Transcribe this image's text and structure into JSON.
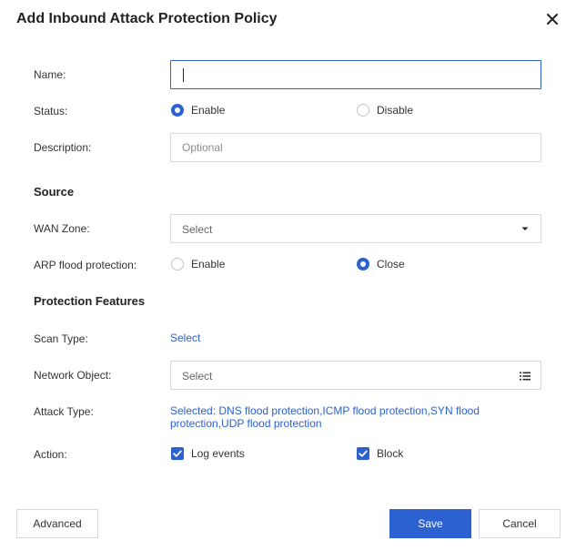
{
  "dialog": {
    "title": "Add Inbound Attack Protection Policy"
  },
  "form": {
    "name_label": "Name:",
    "name_value": "",
    "status_label": "Status:",
    "status_options": [
      "Enable",
      "Disable"
    ],
    "status_selected": "Enable",
    "description_label": "Description:",
    "description_placeholder": "Optional"
  },
  "source": {
    "title": "Source",
    "wan_zone_label": "WAN Zone:",
    "wan_zone_placeholder": "Select",
    "arp_label": "ARP flood protection:",
    "arp_options": [
      "Enable",
      "Close"
    ],
    "arp_selected": "Close"
  },
  "protection": {
    "title": "Protection Features",
    "scan_type_label": "Scan Type:",
    "scan_type_link": "Select",
    "network_object_label": "Network Object:",
    "network_object_placeholder": "Select",
    "attack_type_label": "Attack Type:",
    "attack_type_text": "Selected: DNS flood protection,ICMP flood protection,SYN flood protection,UDP flood protection",
    "action_label": "Action:",
    "action_options": [
      "Log events",
      "Block"
    ],
    "action_checked": [
      "Log events",
      "Block"
    ]
  },
  "footer": {
    "advanced_label": "Advanced",
    "save_label": "Save",
    "cancel_label": "Cancel"
  },
  "colors": {
    "accent": "#2b61d1",
    "border": "#d9d9d9",
    "text": "#333333"
  }
}
